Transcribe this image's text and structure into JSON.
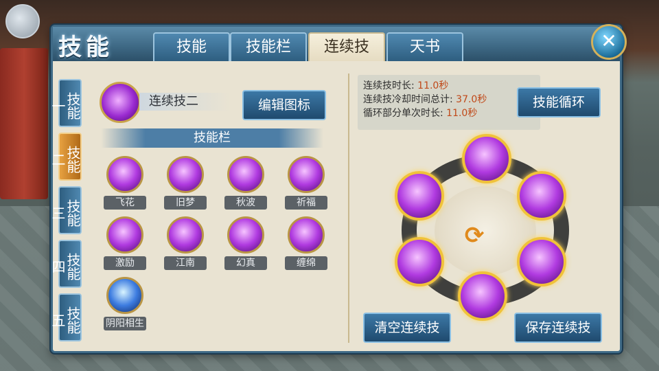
{
  "window": {
    "title": "技能"
  },
  "tabs": [
    {
      "label": "技能"
    },
    {
      "label": "技能栏"
    },
    {
      "label": "连续技",
      "active": true
    },
    {
      "label": "天书"
    }
  ],
  "close": {
    "icon": "close-icon",
    "glyph": "✕"
  },
  "side_tabs": [
    {
      "label": "技能一"
    },
    {
      "label": "技能二",
      "active": true
    },
    {
      "label": "技能三"
    },
    {
      "label": "技能四"
    },
    {
      "label": "技能五"
    }
  ],
  "combo": {
    "name": "连续技二",
    "edit_label": "编辑图标"
  },
  "skillbar": {
    "header": "技能栏",
    "skills": [
      {
        "label": "飞花"
      },
      {
        "label": "旧梦"
      },
      {
        "label": "秋波"
      },
      {
        "label": "祈福"
      },
      {
        "label": "激励"
      },
      {
        "label": "江南"
      },
      {
        "label": "幻真"
      },
      {
        "label": "缠绵"
      },
      {
        "label": "阴阳相生"
      }
    ]
  },
  "stats": {
    "duration_label": "连续技时长:",
    "duration_value": "11.0秒",
    "cooldown_label": "连续技冷却时间总计:",
    "cooldown_value": "37.0秒",
    "loop_label": "循环部分单次时长:",
    "loop_value": "11.0秒"
  },
  "cycle_label": "技能循环",
  "cycle_icon": "refresh-arrows-icon",
  "clear_label": "清空连续技",
  "save_label": "保存连续技",
  "colors": {
    "accent": "#3f6a86",
    "highlight": "#f0c23a",
    "value": "#c04818"
  }
}
